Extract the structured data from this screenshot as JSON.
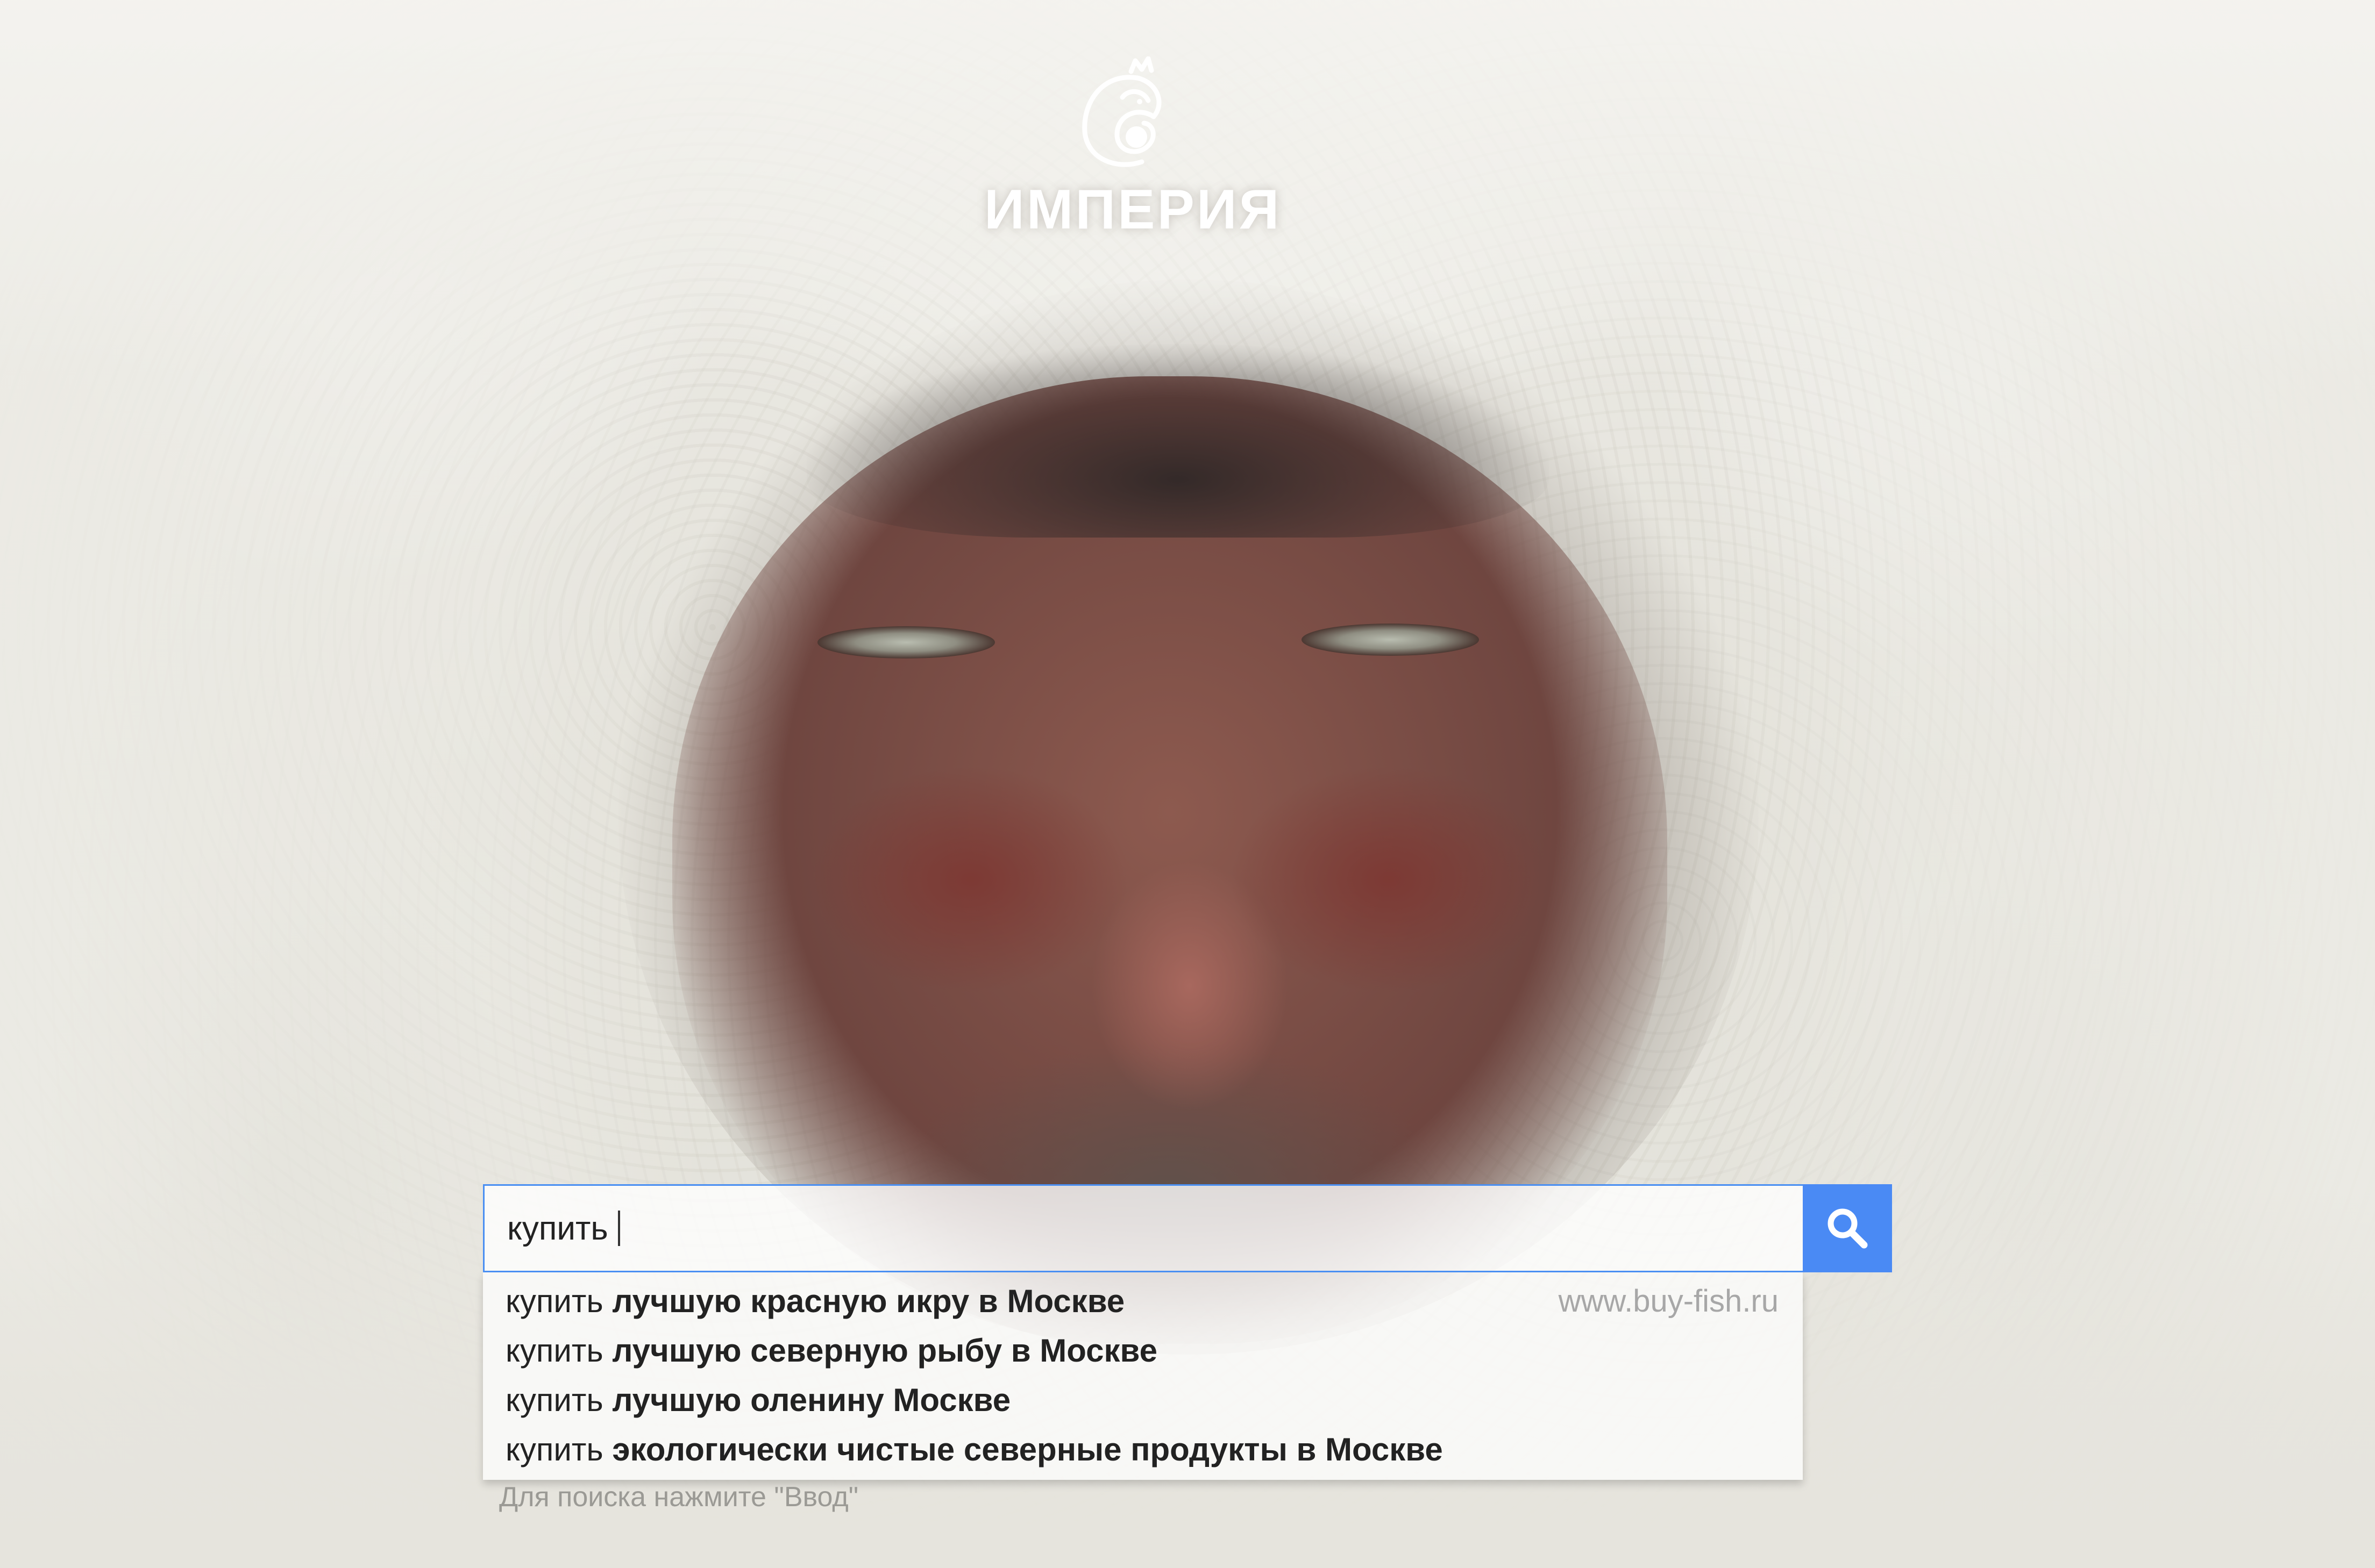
{
  "brand": {
    "name": "ИМПЕРИЯ",
    "logo_icon": "fish-crown-icon"
  },
  "search": {
    "value": "купить",
    "button_icon": "search-icon"
  },
  "suggestions": [
    {
      "prefix": "купить",
      "completion": "лучшую красную икру в Москве",
      "url": "www.buy-fish.ru"
    },
    {
      "prefix": "купить",
      "completion": "лучшую северную рыбу в Москве"
    },
    {
      "prefix": "купить",
      "completion": "лучшую оленину Москве"
    },
    {
      "prefix": "купить",
      "completion": "экологически чистые северные продукты в Москве"
    }
  ],
  "hint": "Для поиска нажмите \"Ввод\"",
  "colors": {
    "accent": "#4a8af4",
    "input_border": "#4a8ff2"
  }
}
